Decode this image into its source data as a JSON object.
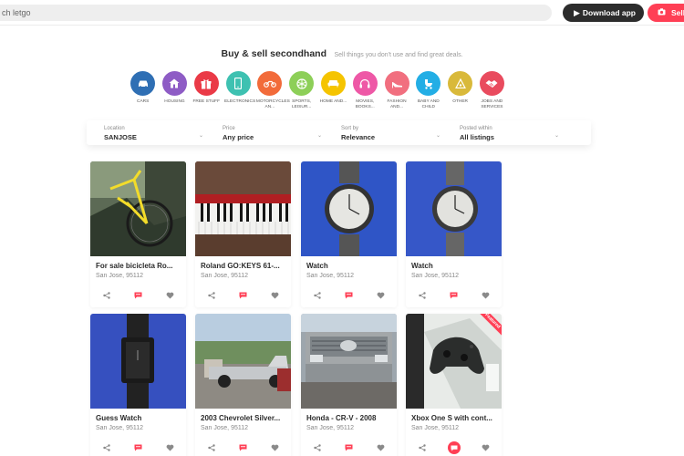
{
  "topbar": {
    "search_value": "ch letgo",
    "download_label": "Download app",
    "sell_label": "Sell"
  },
  "hero": {
    "title": "Buy & sell secondhand",
    "subtitle": "Sell things you don't use and find great deals."
  },
  "categories": [
    {
      "label": "CARS",
      "color": "#2f6fb4",
      "icon": "car-icon"
    },
    {
      "label": "HOUSING",
      "color": "#8e5cc5",
      "icon": "house-icon"
    },
    {
      "label": "FREE STUFF",
      "color": "#ea3a47",
      "icon": "gift-icon"
    },
    {
      "label": "ELECTRONICS",
      "color": "#3ec1b1",
      "icon": "phone-icon"
    },
    {
      "label": "MOTORCYCLES AN...",
      "color": "#f26b3a",
      "icon": "motorcycle-icon"
    },
    {
      "label": "SPORTS, LEISUR...",
      "color": "#8dcf58",
      "icon": "ball-icon"
    },
    {
      "label": "HOME AND...",
      "color": "#f5c400",
      "icon": "couch-icon"
    },
    {
      "label": "MOVIES, BOOKS...",
      "color": "#ee58a6",
      "icon": "headphones-icon"
    },
    {
      "label": "FASHION AND...",
      "color": "#f16f7f",
      "icon": "heel-icon"
    },
    {
      "label": "BABY AND CHILD",
      "color": "#23aee5",
      "icon": "stroller-icon"
    },
    {
      "label": "OTHER",
      "color": "#d9b93a",
      "icon": "other-icon"
    },
    {
      "label": "JOBS AND SERVICES",
      "color": "#e94b5e",
      "icon": "handshake-icon"
    }
  ],
  "filters": [
    {
      "label": "Location",
      "value": "SANJOSE"
    },
    {
      "label": "Price",
      "value": "Any price"
    },
    {
      "label": "Sort by",
      "value": "Relevance"
    },
    {
      "label": "Posted within",
      "value": "All listings"
    }
  ],
  "listings": [
    {
      "title": "For sale bicicleta Ro...",
      "location": "San Jose, 95112"
    },
    {
      "title": "Roland GO:KEYS 61-...",
      "location": "San Jose, 95112"
    },
    {
      "title": "Watch",
      "location": "San Jose, 95112"
    },
    {
      "title": "Watch",
      "location": "San Jose, 95112"
    },
    {
      "title": "Guess Watch",
      "location": "San Jose, 95112"
    },
    {
      "title": "2003 Chevrolet Silver...",
      "location": "San Jose, 95112"
    },
    {
      "title": "Honda - CR-V - 2008",
      "location": "San Jose, 95112"
    },
    {
      "title": "Xbox One S with cont...",
      "location": "San Jose, 95112",
      "badge": "Featured"
    }
  ],
  "colors": {
    "accent": "#ff3f55",
    "dark_button": "#2c2c2c"
  }
}
